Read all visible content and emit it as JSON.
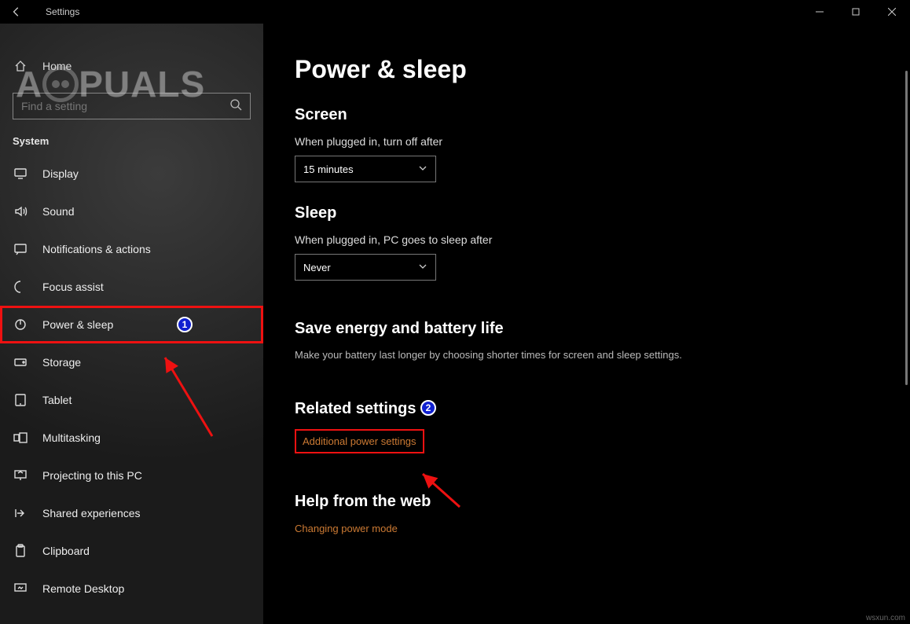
{
  "window": {
    "title": "Settings"
  },
  "sidebar": {
    "home": "Home",
    "search_placeholder": "Find a setting",
    "category": "System",
    "items": [
      {
        "label": "Display"
      },
      {
        "label": "Sound"
      },
      {
        "label": "Notifications & actions"
      },
      {
        "label": "Focus assist"
      },
      {
        "label": "Power & sleep"
      },
      {
        "label": "Storage"
      },
      {
        "label": "Tablet"
      },
      {
        "label": "Multitasking"
      },
      {
        "label": "Projecting to this PC"
      },
      {
        "label": "Shared experiences"
      },
      {
        "label": "Clipboard"
      },
      {
        "label": "Remote Desktop"
      }
    ]
  },
  "main": {
    "title": "Power & sleep",
    "screen": {
      "heading": "Screen",
      "plugged_label": "When plugged in, turn off after",
      "plugged_value": "15 minutes"
    },
    "sleep": {
      "heading": "Sleep",
      "plugged_label": "When plugged in, PC goes to sleep after",
      "plugged_value": "Never"
    },
    "energy": {
      "heading": "Save energy and battery life",
      "desc": "Make your battery last longer by choosing shorter times for screen and sleep settings."
    },
    "related": {
      "heading": "Related settings",
      "link": "Additional power settings"
    },
    "help": {
      "heading": "Help from the web",
      "link": "Changing power mode"
    }
  },
  "watermark": "A PUALS",
  "annotations": {
    "badge1": "1",
    "badge2": "2"
  },
  "footer": "wsxun.com"
}
